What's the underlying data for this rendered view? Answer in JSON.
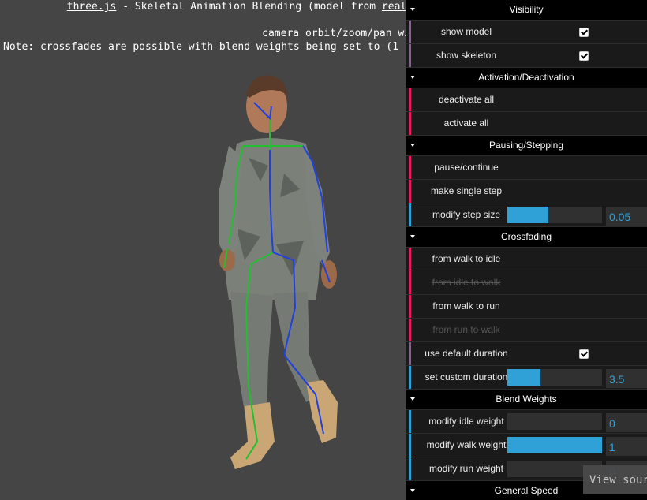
{
  "info": {
    "link1": "three.js",
    "line1_text": " - Skeletal Animation Blending (model from ",
    "link2": "real",
    "line2": "camera orbit/zoom/pan with left/middle/right mou",
    "line3": "Note: crossfades are possible with blend weights being set to (1"
  },
  "gui": {
    "visibility": {
      "title": "Visibility",
      "show_model": "show model",
      "show_skeleton": "show skeleton"
    },
    "activation": {
      "title": "Activation/Deactivation",
      "deactivate_all": "deactivate all",
      "activate_all": "activate all"
    },
    "pausing": {
      "title": "Pausing/Stepping",
      "pause_continue": "pause/continue",
      "single_step": "make single step",
      "step_size_label": "modify step size",
      "step_size_value": "0.05",
      "step_size_fraction": 0.43
    },
    "crossfading": {
      "title": "Crossfading",
      "walk_to_idle": "from walk to idle",
      "idle_to_walk": "from idle to walk",
      "walk_to_run": "from walk to run",
      "run_to_walk": "from run to walk",
      "use_default_duration": "use default duration",
      "custom_duration_label": "set custom duration",
      "custom_duration_value": "3.5",
      "custom_duration_fraction": 0.35
    },
    "blend_weights": {
      "title": "Blend Weights",
      "idle_label": "modify idle weight",
      "idle_value": "0",
      "idle_fraction": 0,
      "walk_label": "modify walk weight",
      "walk_value": "1",
      "walk_fraction": 1,
      "run_label": "modify run weight",
      "run_value": "0",
      "run_fraction": 0
    },
    "next_title": "General Speed"
  },
  "view_source": "View sour",
  "colors": {
    "background": "#454545",
    "function_bar": "#e61d5f",
    "boolean_bar": "#806787",
    "number_bar": "#2fa1d6"
  }
}
